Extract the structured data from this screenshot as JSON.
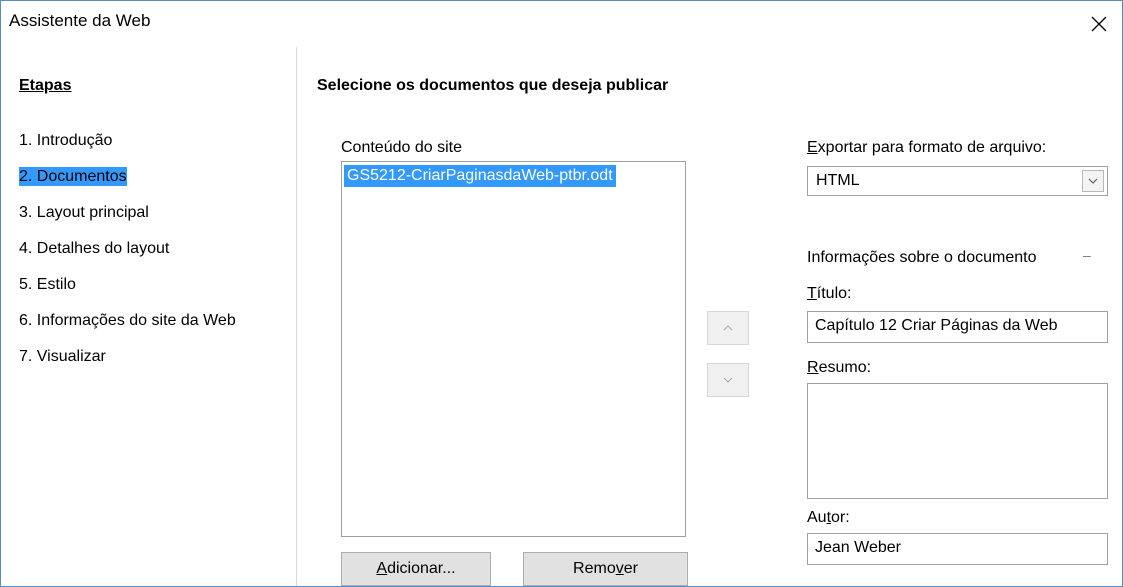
{
  "window": {
    "title": "Assistente da Web",
    "close_icon": "close-icon"
  },
  "sidebar": {
    "header": "Etapas",
    "steps": [
      {
        "label": "1. Introdução",
        "selected": false
      },
      {
        "label": "2. Documentos",
        "selected": true
      },
      {
        "label": "3. Layout principal",
        "selected": false
      },
      {
        "label": "4. Detalhes do layout",
        "selected": false
      },
      {
        "label": "5. Estilo",
        "selected": false
      },
      {
        "label": "6. Informações do site da Web",
        "selected": false
      },
      {
        "label": "7. Visualizar",
        "selected": false
      }
    ]
  },
  "main": {
    "title": "Selecione os documentos que deseja publicar",
    "content_label": "Conteúdo do site",
    "documents": [
      "GS5212-CriarPaginasdaWeb-ptbr.odt"
    ],
    "add_button": {
      "pre": "",
      "mnemonic": "A",
      "post": "dicionar..."
    },
    "remove_button": {
      "pre": "Remo",
      "mnemonic": "v",
      "post": "er"
    },
    "move_up_icon": "chevron-up-icon",
    "move_down_icon": "chevron-down-icon",
    "export_label": {
      "pre": "",
      "mnemonic": "E",
      "post": "xportar para formato de arquivo:"
    },
    "export_format": "HTML",
    "doc_info_label": "Informações sobre o documento",
    "doc_info_toggle": "–",
    "title_label": {
      "pre": "",
      "mnemonic": "T",
      "post": "ítulo:"
    },
    "title_value": "Capítulo 12 Criar Páginas da Web",
    "summary_label": {
      "pre": "",
      "mnemonic": "R",
      "post": "esumo:"
    },
    "summary_value": "",
    "author_label": {
      "pre": "Au",
      "mnemonic": "t",
      "post": "or:"
    },
    "author_value": "Jean Weber"
  },
  "colors": {
    "selection": "#3399ff",
    "border": "#5a8dbb"
  }
}
